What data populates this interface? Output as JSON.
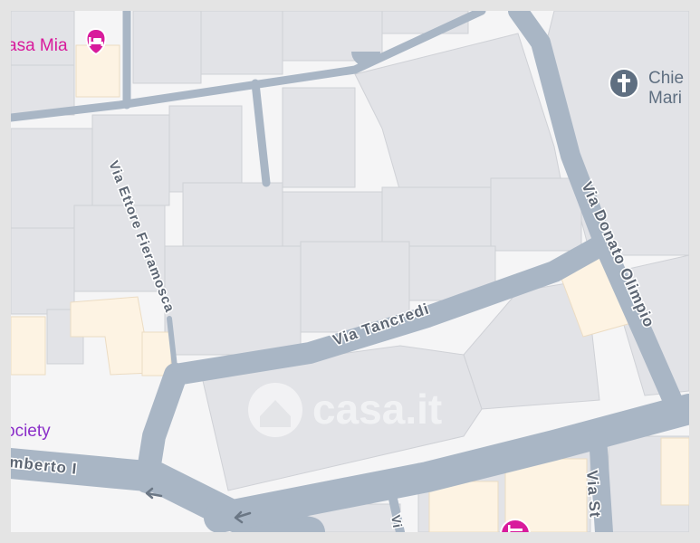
{
  "streets": {
    "tancredi": "Via Tancredi",
    "fieramosca": "Via Ettore Fieramosca",
    "olimpio": "Via Donato Olimpio",
    "umberto": "mberto I",
    "stub_right": "Via St",
    "stub_bottom": "Vi"
  },
  "pois": {
    "hotel_top": {
      "label": "asa Mia",
      "icon": "bed-icon",
      "color": "#d81b9c"
    },
    "church": {
      "label_line1": "Chie",
      "label_line2": "Mari",
      "icon": "cross-icon",
      "color": "#5f6f81"
    },
    "society": {
      "label": "ociety",
      "color": "#8b2fc9"
    },
    "hotel_bottom": {
      "icon": "bed-icon",
      "color": "#d81b9c"
    }
  },
  "watermark": {
    "text": "casa.it"
  },
  "colors": {
    "road": "#a9b6c5",
    "building": "#e2e3e7",
    "building_edge": "#cfd1d6",
    "highlight_block": "#fdf3e3",
    "background": "#f5f5f6"
  }
}
